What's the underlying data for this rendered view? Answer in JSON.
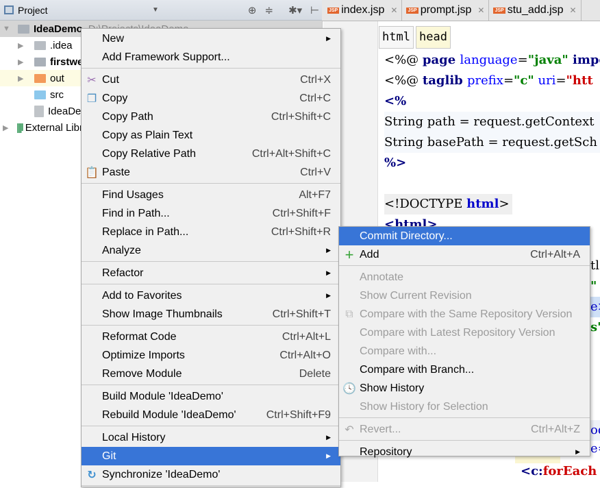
{
  "project_panel": {
    "title": "Project",
    "tree": [
      {
        "label": "IdeaDemo",
        "path": "D:\\Projects\\IdeaDemo",
        "bold": true
      },
      {
        "label": ".idea"
      },
      {
        "label": "firstweb",
        "bold": true
      },
      {
        "label": "out"
      },
      {
        "label": "src"
      },
      {
        "label": "IdeaDemo.iml"
      },
      {
        "label": "External Libraries"
      }
    ]
  },
  "tabs": [
    {
      "label": "index.jsp"
    },
    {
      "label": "prompt.jsp"
    },
    {
      "label": "stu_add.jsp"
    }
  ],
  "breadcrumb": [
    "html",
    "head"
  ],
  "code": {
    "l1": [
      "<%@ ",
      "page ",
      "language",
      "=",
      "\"java\"",
      " impor"
    ],
    "l2": [
      "<%@ ",
      "taglib ",
      "prefix",
      "=",
      "\"c\"",
      " uri",
      "=",
      "\"htt"
    ],
    "l3": "<%",
    "l4": "String path = request.getContext",
    "l5": "String basePath = request.getSch",
    "l6": "%>",
    "l7a": "<!DOCTYPE ",
    "l7b": "html",
    "l7c": ">",
    "l8": "<html>",
    "frag1": "tl",
    "frag2": "\" /",
    "frag3": "e>",
    "frag4": "s\"",
    "frag5": "od",
    "frag6": "e=",
    "foreach_a": "<c:",
    "foreach_b": "forEach"
  },
  "context_menu": {
    "new": "New",
    "add_framework": "Add Framework Support...",
    "cut": "Cut",
    "cut_sc": "Ctrl+X",
    "copy": "Copy",
    "copy_sc": "Ctrl+C",
    "copy_path": "Copy Path",
    "copy_path_sc": "Ctrl+Shift+C",
    "copy_plain": "Copy as Plain Text",
    "copy_relative": "Copy Relative Path",
    "copy_relative_sc": "Ctrl+Alt+Shift+C",
    "paste": "Paste",
    "paste_sc": "Ctrl+V",
    "find_usages": "Find Usages",
    "find_usages_sc": "Alt+F7",
    "find_in_path": "Find in Path...",
    "find_in_path_sc": "Ctrl+Shift+F",
    "replace_in_path": "Replace in Path...",
    "replace_in_path_sc": "Ctrl+Shift+R",
    "analyze": "Analyze",
    "refactor": "Refactor",
    "add_favorites": "Add to Favorites",
    "show_thumbnails": "Show Image Thumbnails",
    "show_thumbnails_sc": "Ctrl+Shift+T",
    "reformat": "Reformat Code",
    "reformat_sc": "Ctrl+Alt+L",
    "optimize": "Optimize Imports",
    "optimize_sc": "Ctrl+Alt+O",
    "remove_module": "Remove Module",
    "remove_module_sc": "Delete",
    "build_module": "Build Module 'IdeaDemo'",
    "rebuild_module": "Rebuild Module 'IdeaDemo'",
    "rebuild_module_sc": "Ctrl+Shift+F9",
    "local_history": "Local History",
    "git": "Git",
    "synchronize": "Synchronize 'IdeaDemo'"
  },
  "git_menu": {
    "commit_dir": "Commit Directory...",
    "add": "Add",
    "add_sc": "Ctrl+Alt+A",
    "annotate": "Annotate",
    "show_current_revision": "Show Current Revision",
    "compare_same": "Compare with the Same Repository Version",
    "compare_latest": "Compare with Latest Repository Version",
    "compare_with": "Compare with...",
    "compare_branch": "Compare with Branch...",
    "show_history": "Show History",
    "show_history_selection": "Show History for Selection",
    "revert": "Revert...",
    "revert_sc": "Ctrl+Alt+Z",
    "repository": "Repository"
  },
  "colors": {
    "highlight": "#3875d7",
    "menu_bg": "#f0f0f0",
    "disabled": "#9c9c9c"
  }
}
